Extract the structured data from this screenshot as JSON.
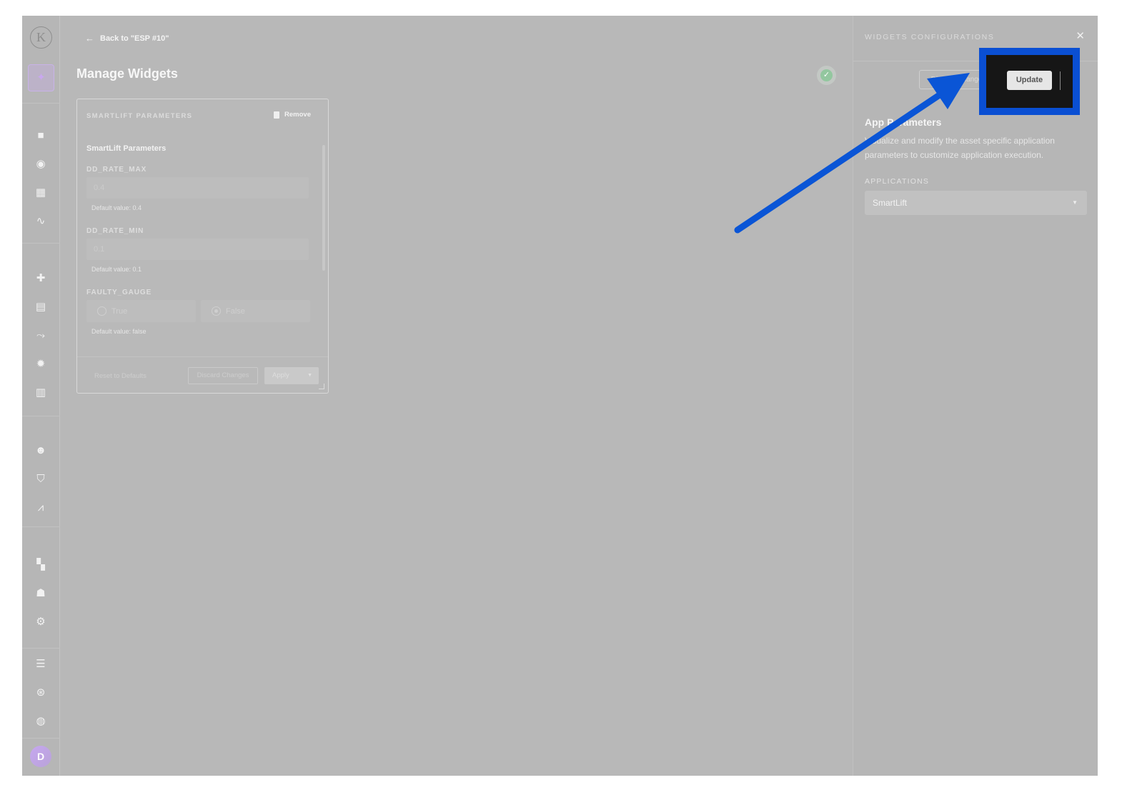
{
  "main": {
    "back_link": "Back to \"ESP #10\"",
    "page_title": "Manage Widgets"
  },
  "sidebar": {
    "logo": "K",
    "avatar_initial": "D",
    "icons": [
      "sparkle-icon",
      "briefcase-icon",
      "globe-icon",
      "dashboard-icon",
      "pulse-icon",
      "puzzle-icon",
      "bar-chart-icon",
      "route-icon",
      "gear-icon",
      "store-icon",
      "support-icon",
      "shield-icon",
      "line-chart-icon",
      "widgets-icon",
      "users-icon",
      "user-settings-icon",
      "document-icon",
      "lifebuoy-icon",
      "world-icon"
    ]
  },
  "widget": {
    "header": "SMARTLIFT PARAMETERS",
    "remove_label": "Remove",
    "section_title": "SmartLift Parameters",
    "params": [
      {
        "label": "DD_RATE_MAX",
        "value": "0.4",
        "default": "Default value: 0.4"
      },
      {
        "label": "DD_RATE_MIN",
        "value": "0.1",
        "default": "Default value: 0.1"
      }
    ],
    "faulty_gauge": {
      "label": "FAULTY_GAUGE",
      "option_true": "True",
      "option_false": "False",
      "selected": "False",
      "default": "Default value: false"
    },
    "footer": {
      "reset": "Reset to Defaults",
      "discard": "Discard Changes",
      "apply": "Apply"
    }
  },
  "panel": {
    "title": "WIDGETS CONFIGURATIONS",
    "discard_label": "Discard Changes",
    "update_label": "Update",
    "app_title": "App Parameters",
    "app_description": "Visualize and modify the asset specific application parameters to customize application execution.",
    "applications_label": "APPLICATIONS",
    "applications_selected": "SmartLift"
  },
  "colors": {
    "highlight_border": "#0a4fd3",
    "arrow": "#0a55d6",
    "check": "#93c79f",
    "accent": "#c9a7ef"
  }
}
